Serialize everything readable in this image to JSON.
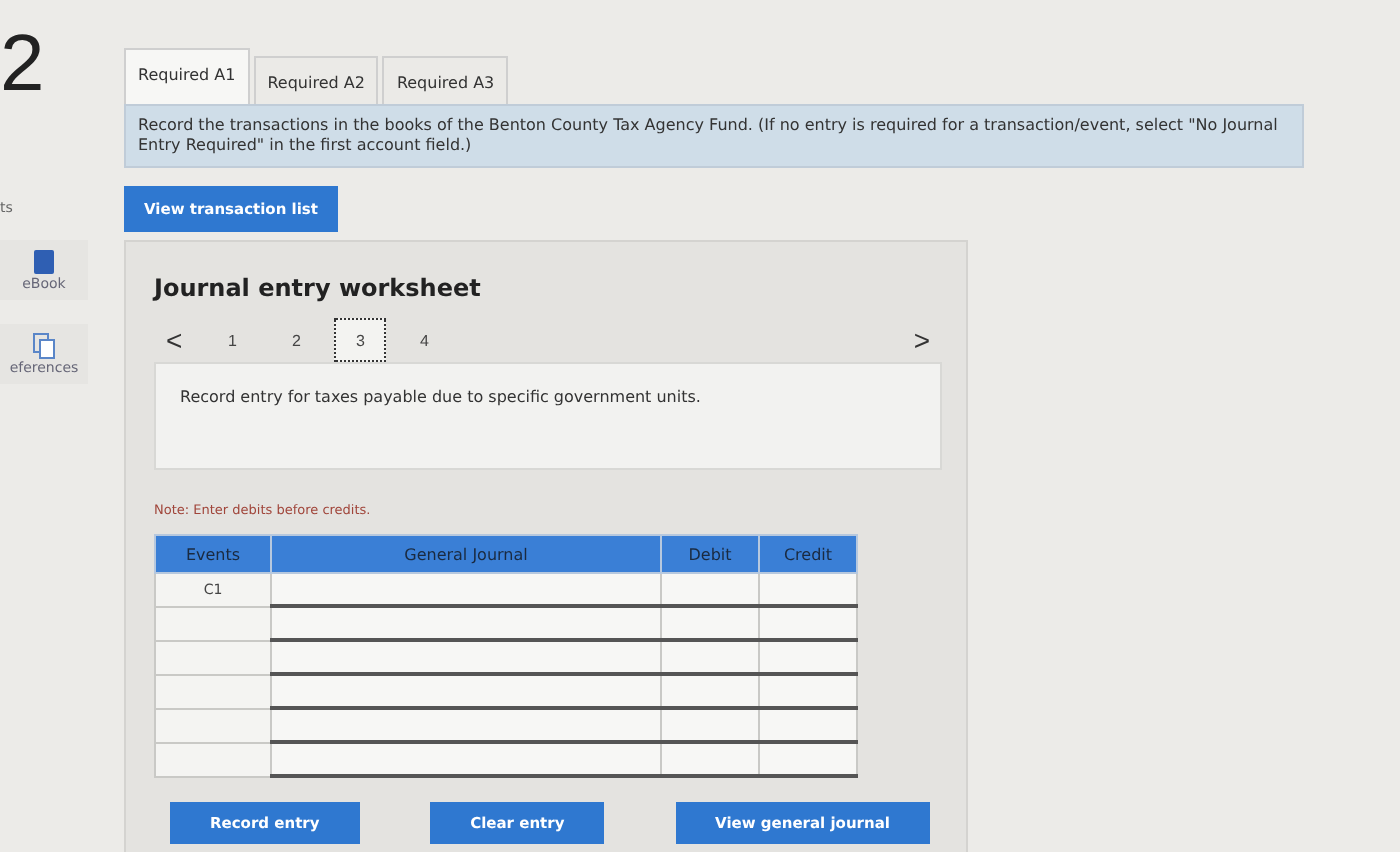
{
  "question_number": "2",
  "sidebar": {
    "items": [
      {
        "label": "ts",
        "kind": "text"
      },
      {
        "label": "eBook",
        "kind": "book"
      },
      {
        "label": "eferences",
        "kind": "docs"
      }
    ]
  },
  "tabs": [
    {
      "label": "Required A1",
      "selected": true
    },
    {
      "label": "Required A2",
      "selected": false
    },
    {
      "label": "Required A3",
      "selected": false
    }
  ],
  "instruction": "Record the transactions in the books of the Benton County Tax Agency Fund. (If no entry is required for a transaction/event, select \"No Journal Entry Required\" in the first account field.)",
  "view_button": "View transaction list",
  "worksheet": {
    "title": "Journal entry worksheet",
    "prev": "<",
    "next": ">",
    "pages": [
      {
        "label": "1",
        "selected": false
      },
      {
        "label": "2",
        "selected": false
      },
      {
        "label": "3",
        "selected": true
      },
      {
        "label": "4",
        "selected": false
      }
    ],
    "prompt": "Record entry for taxes payable due to specific government units.",
    "note": "Note: Enter debits before credits.",
    "columns": [
      "Events",
      "General Journal",
      "Debit",
      "Credit"
    ],
    "rows": [
      {
        "event": "C1"
      },
      {},
      {},
      {},
      {},
      {}
    ],
    "buttons": [
      "Record entry",
      "Clear entry",
      "View general journal"
    ]
  }
}
